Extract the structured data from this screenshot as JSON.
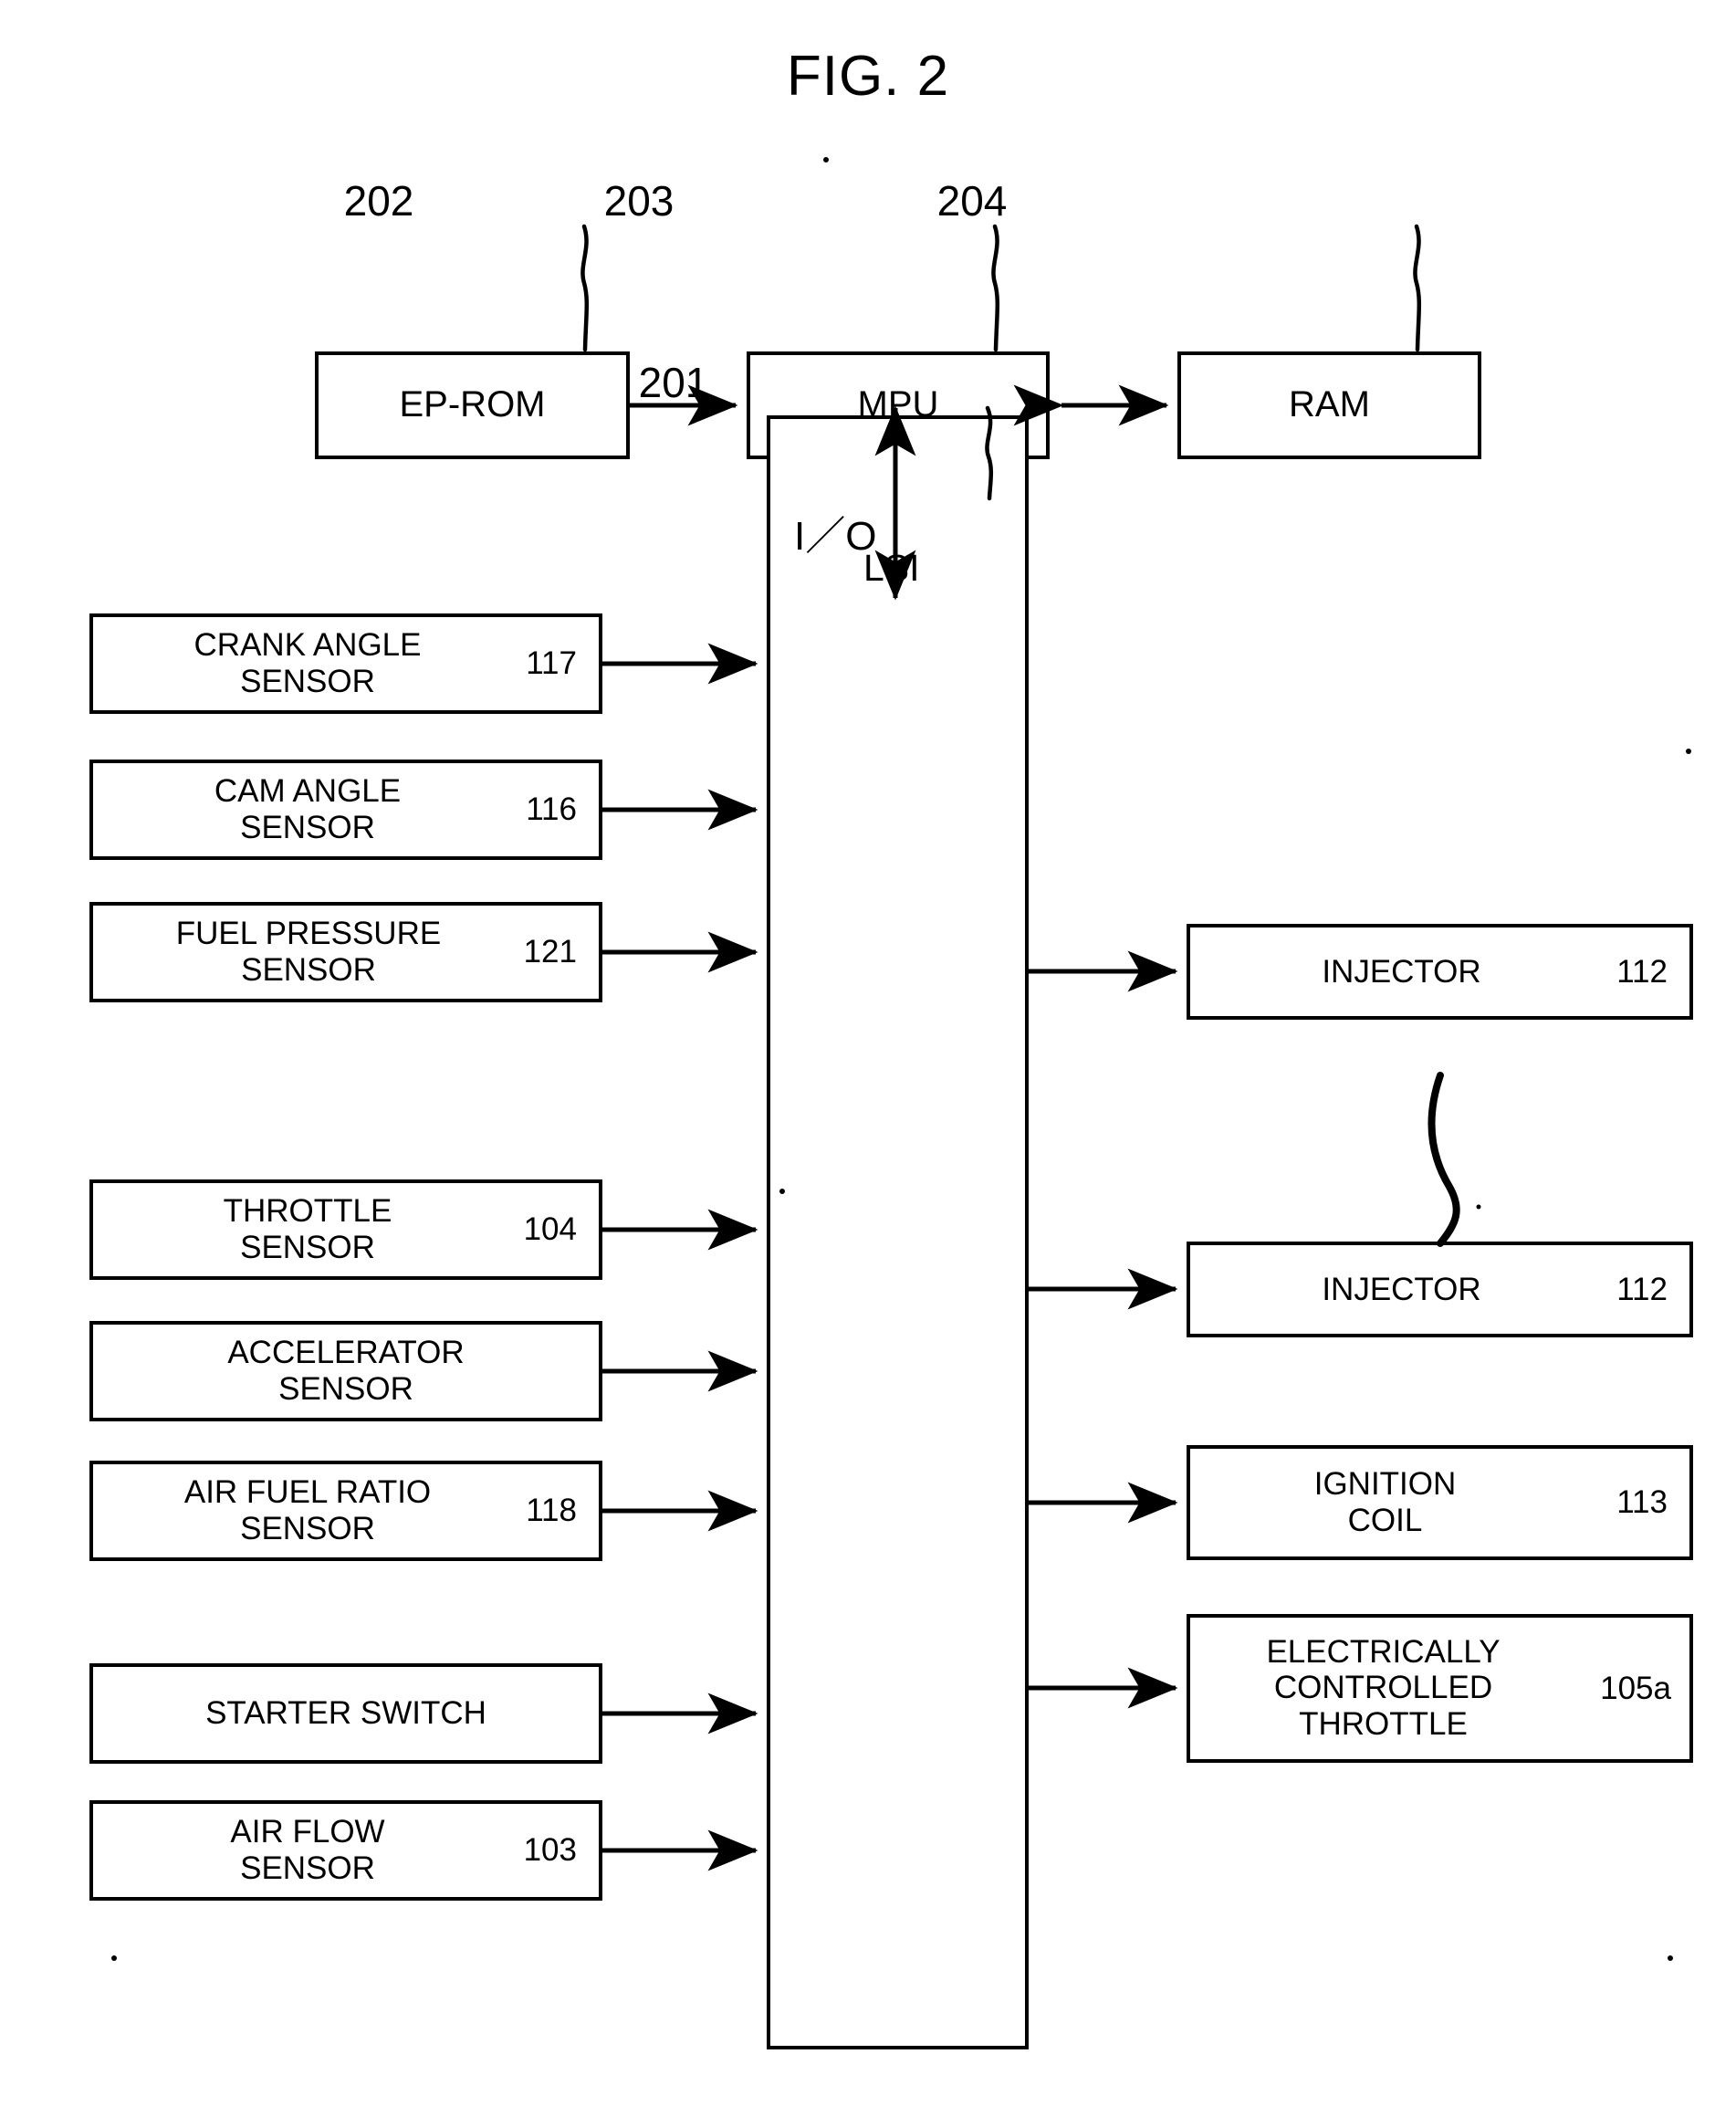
{
  "figure": {
    "title": "FIG. 2"
  },
  "core": {
    "eprom": {
      "label": "EP-ROM",
      "ref": "202"
    },
    "mpu": {
      "label": "MPU",
      "ref": "203"
    },
    "ram": {
      "label": "RAM",
      "ref": "204"
    },
    "io_lsi": {
      "label_line1": "I／O",
      "label_line2": "LSI",
      "ref": "201"
    }
  },
  "inputs": [
    {
      "label": "CRANK ANGLE\nSENSOR",
      "ref": "117"
    },
    {
      "label": "CAM ANGLE\nSENSOR",
      "ref": "116"
    },
    {
      "label": "FUEL PRESSURE\nSENSOR",
      "ref": "121"
    },
    {
      "label": "THROTTLE\nSENSOR",
      "ref": "104"
    },
    {
      "label": "ACCELERATOR\nSENSOR",
      "ref": ""
    },
    {
      "label": "AIR FUEL RATIO\nSENSOR",
      "ref": "118"
    },
    {
      "label": "STARTER SWITCH",
      "ref": ""
    },
    {
      "label": "AIR FLOW\nSENSOR",
      "ref": "103"
    }
  ],
  "outputs": [
    {
      "label": "INJECTOR",
      "ref": "112"
    },
    {
      "label": "INJECTOR",
      "ref": "112"
    },
    {
      "label": "IGNITION\nCOIL",
      "ref": "113"
    },
    {
      "label": "ELECTRICALLY\nCONTROLLED\nTHROTTLE",
      "ref": "105a"
    }
  ]
}
